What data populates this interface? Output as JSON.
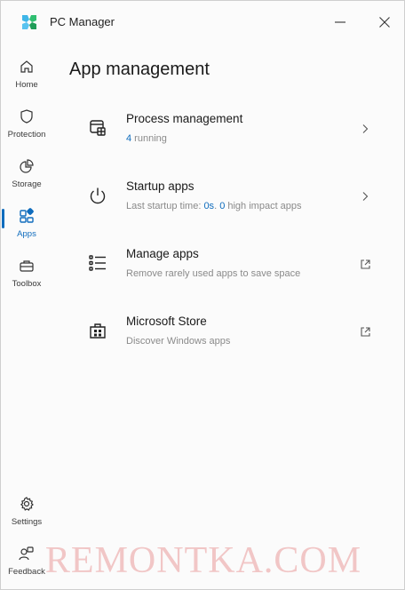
{
  "window": {
    "title": "PC Manager"
  },
  "nav": {
    "items": [
      {
        "label": "Home",
        "icon": "home-icon"
      },
      {
        "label": "Protection",
        "icon": "shield-icon"
      },
      {
        "label": "Storage",
        "icon": "pie-chart-icon"
      },
      {
        "label": "Apps",
        "icon": "apps-icon",
        "active": true
      },
      {
        "label": "Toolbox",
        "icon": "toolbox-icon"
      }
    ],
    "bottom": [
      {
        "label": "Settings",
        "icon": "gear-icon"
      },
      {
        "label": "Feedback",
        "icon": "feedback-icon"
      }
    ]
  },
  "main": {
    "title": "App management",
    "cards": [
      {
        "title": "Process management",
        "sub_count": "4",
        "sub_text": " running",
        "action": "chevron-right-icon"
      },
      {
        "title": "Startup apps",
        "sub_prefix": "Last startup time: ",
        "sub_time": "0s",
        "sub_mid": ". ",
        "sub_count": "0",
        "sub_suffix": " high impact apps",
        "action": "chevron-right-icon"
      },
      {
        "title": "Manage apps",
        "sub": "Remove rarely used apps to save space",
        "action": "open-external-icon"
      },
      {
        "title": "Microsoft Store",
        "sub": "Discover Windows apps",
        "action": "open-external-icon"
      }
    ]
  },
  "watermark": "REMONTKA.COM",
  "colors": {
    "accent": "#0f6cbd",
    "background": "#fbfbfb"
  }
}
